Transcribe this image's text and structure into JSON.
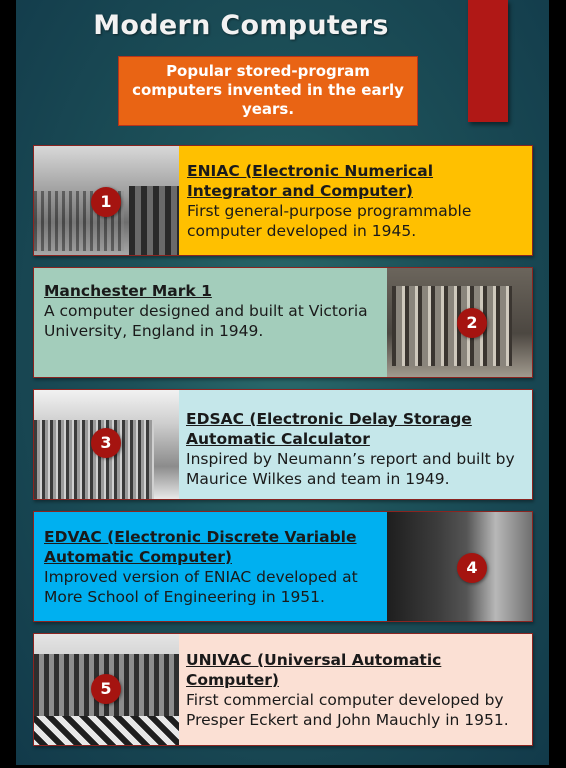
{
  "title": "Modern Computers",
  "subtitle": "Popular stored-program computers invented in the early years.",
  "colors": {
    "background": "#1d5159",
    "accent_bar": "#b01816",
    "subtitle_box": "#e96414",
    "badge": "#a51410"
  },
  "cards": [
    {
      "number": "1",
      "heading": "ENIAC (Electronic Numerical Integrator and Computer)",
      "description": "First  general-purpose programmable computer developed in 1945.",
      "color": "#ffc000",
      "image": "ENIAC photo"
    },
    {
      "number": "2",
      "heading": "Manchester Mark 1",
      "description": "A computer designed and built at Victoria University, England in 1949.",
      "color": "#a3cdbb",
      "image": "Manchester Mark 1 photo"
    },
    {
      "number": "3",
      "heading": "EDSAC (Electronic Delay Storage Automatic Calculator",
      "description": "Inspired by Neumann’s report and built by Maurice Wilkes and team in 1949.",
      "color": "#c5e7ea",
      "image": "EDSAC photo"
    },
    {
      "number": "4",
      "heading": "EDVAC (Electronic Discrete Variable Automatic Computer)",
      "description": "Improved version of ENIAC developed at More School of Engineering in 1951.",
      "color": "#00b0f0",
      "image": "EDVAC photo"
    },
    {
      "number": "5",
      "heading": "UNIVAC (Universal Automatic Computer)",
      "description": "First commercial computer developed by Presper Eckert and John Mauchly in 1951.",
      "color": "#fbe0d4",
      "image": "UNIVAC photo"
    }
  ]
}
